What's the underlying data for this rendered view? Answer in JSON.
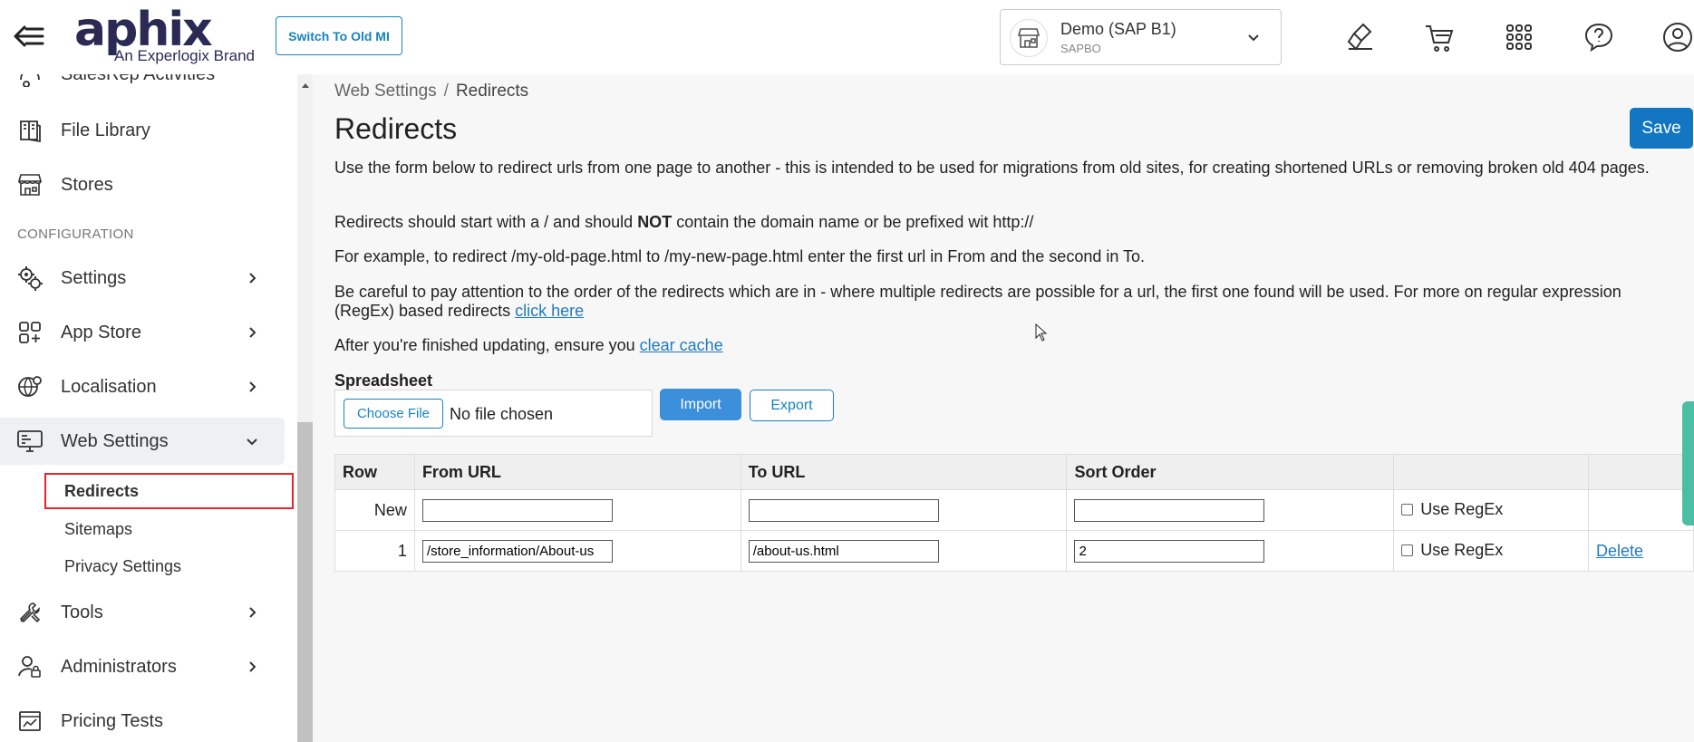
{
  "header": {
    "logo_text": "aphix",
    "logo_sub": "An Experlogix Brand",
    "switch_label": "Switch To Old MI",
    "store": {
      "name": "Demo (SAP B1)",
      "sub": "SAPBO"
    }
  },
  "sidebar": {
    "items_top": [
      {
        "label": "SalesRep Activities",
        "icon": "activities-icon"
      },
      {
        "label": "File Library",
        "icon": "book-icon"
      },
      {
        "label": "Stores",
        "icon": "store-icon"
      }
    ],
    "section_config": "CONFIGURATION",
    "items_config": [
      {
        "label": "Settings",
        "icon": "gears-icon"
      },
      {
        "label": "App Store",
        "icon": "apps-plus-icon"
      },
      {
        "label": "Localisation",
        "icon": "globe-gear-icon"
      },
      {
        "label": "Web Settings",
        "icon": "monitor-settings-icon"
      }
    ],
    "web_settings_sub": [
      {
        "label": "Redirects"
      },
      {
        "label": "Sitemaps"
      },
      {
        "label": "Privacy Settings"
      }
    ],
    "items_bottom": [
      {
        "label": "Tools",
        "icon": "tools-icon"
      },
      {
        "label": "Administrators",
        "icon": "admin-lock-icon"
      },
      {
        "label": "Pricing Tests",
        "icon": "pricing-test-icon"
      }
    ]
  },
  "main": {
    "breadcrumb": [
      "Web Settings",
      "Redirects"
    ],
    "title": "Redirects",
    "save_label": "Save",
    "p1": "Use the form below to redirect urls from one page to another - this is intended to be used for migrations from old sites, for creating shortened URLs or removing broken old 404 pages.",
    "p2_a": "Redirects should start with a / and should ",
    "p2_bold": "NOT",
    "p2_b": " contain the domain name or be prefixed wit http://",
    "p3": "For example, to redirect /my-old-page.html to /my-new-page.html enter the first url in From and the second in To.",
    "p4": "Be careful to pay attention to the order of the redirects which are in - where multiple redirects are possible for a url, the first one found will be used. For more on regular expression (RegEx) based redirects ",
    "p4_link": "click here",
    "p5": "After you're finished updating, ensure you ",
    "p5_link": "clear cache",
    "spreadsheet_label": "Spreadsheet",
    "choose_file": "Choose File",
    "no_file": "No file chosen",
    "import_label": "Import",
    "export_label": "Export",
    "table": {
      "headers": [
        "Row",
        "From URL",
        "To URL",
        "Sort Order",
        "",
        ""
      ],
      "rows": [
        {
          "row": "New",
          "from": "",
          "to": "",
          "sort": "",
          "regex_label": "Use RegEx",
          "action": ""
        },
        {
          "row": "1",
          "from": "/store_information/About-us",
          "to": "/about-us.html",
          "sort": "2",
          "regex_label": "Use RegEx",
          "action": "Delete"
        }
      ]
    }
  },
  "colors": {
    "primary": "#1276c2",
    "link": "#1f7ac4",
    "highlight": "#e5252a",
    "brand": "#2a2a55"
  }
}
